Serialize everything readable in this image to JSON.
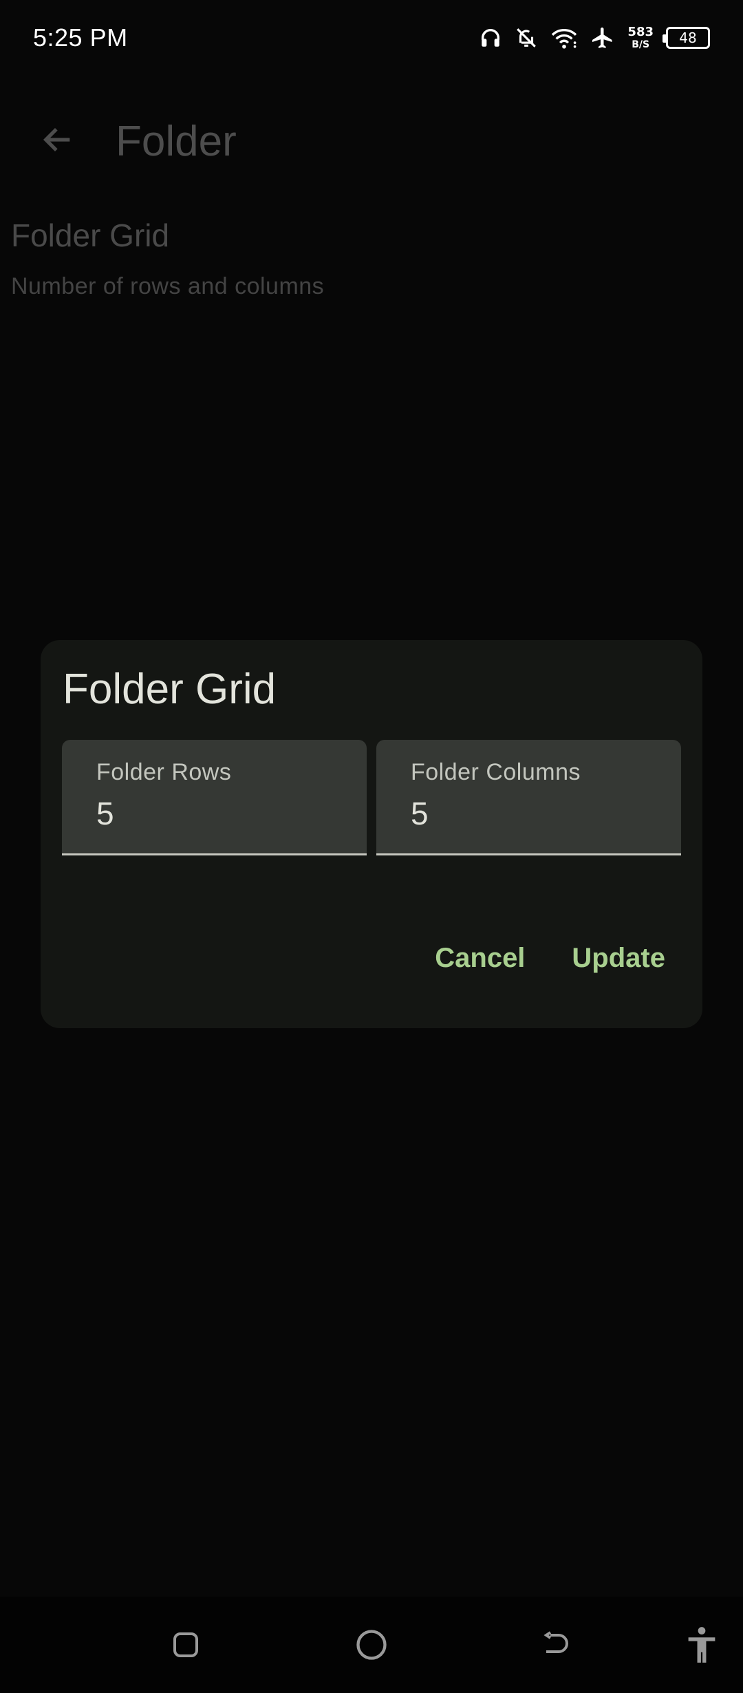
{
  "status_bar": {
    "time": "5:25 PM",
    "net_speed_value": "583",
    "net_speed_unit": "B/S",
    "battery_level": "48",
    "icons": [
      "headset-icon",
      "notifications-off-icon",
      "wifi-icon",
      "airplane-mode-icon"
    ]
  },
  "app_bar": {
    "title": "Folder",
    "back_icon": "arrow-back-icon"
  },
  "preference": {
    "title": "Folder Grid",
    "summary": "Number of rows and columns"
  },
  "dialog": {
    "title": "Folder Grid",
    "fields": [
      {
        "label": "Folder Rows",
        "value": "5"
      },
      {
        "label": "Folder Columns",
        "value": "5"
      }
    ],
    "actions": {
      "cancel": "Cancel",
      "update": "Update"
    },
    "accent_color": "#a8cf8f"
  },
  "nav_bar": {
    "icons": [
      "recents-icon",
      "home-icon",
      "back-icon",
      "accessibility-icon"
    ]
  }
}
